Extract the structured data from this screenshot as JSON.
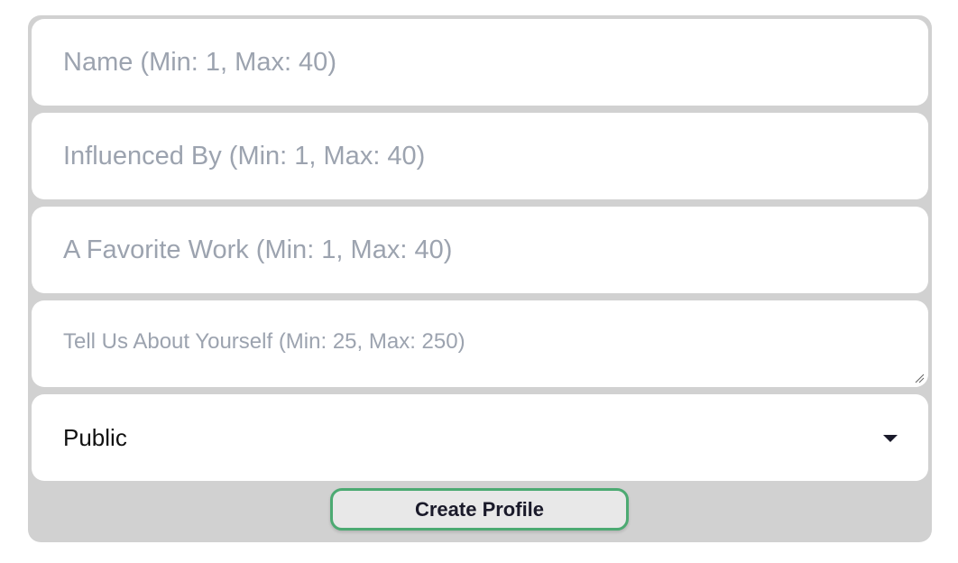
{
  "form": {
    "name_placeholder": "Name (Min: 1, Max: 40)",
    "influenced_placeholder": "Influenced By (Min: 1, Max: 40)",
    "favorite_work_placeholder": "A Favorite Work (Min: 1, Max: 40)",
    "about_placeholder": "Tell Us About Yourself (Min: 25, Max: 250)",
    "visibility_selected": "Public",
    "submit_label": "Create Profile"
  },
  "colors": {
    "accent": "#4caa72",
    "background": "#d1d1d1"
  }
}
